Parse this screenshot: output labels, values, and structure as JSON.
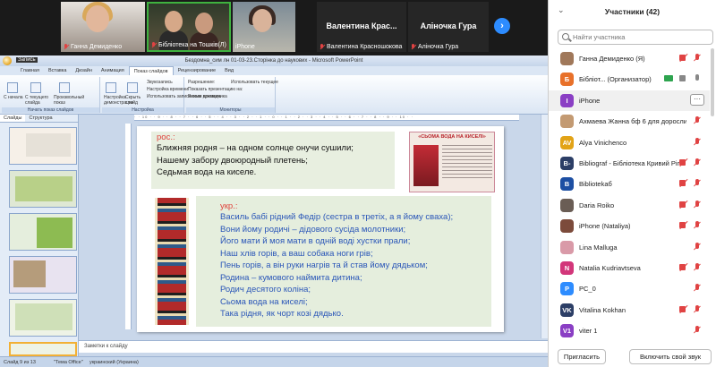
{
  "video": {
    "tiles": [
      {
        "name": "Ганна Демиденко"
      },
      {
        "name": "Бібліотека на Тошків(Л)"
      },
      {
        "name": "iPhone"
      },
      {
        "name": "Валентина Красношокова",
        "big": "Валентина Крас..."
      },
      {
        "name": "Аліночка Гура",
        "big": "Аліночка Гура"
      }
    ]
  },
  "ppt": {
    "recording_label": "Запись",
    "window_title": "Бездомна_сим лн 01-03-23.Сторінка до наукових - Microsoft PowerPoint",
    "tabs": [
      "Главная",
      "Вставка",
      "Дизайн",
      "Анимация",
      "Показ слайдов",
      "Рецензирование",
      "Вид"
    ],
    "ribbon": {
      "groups": [
        "Начать показ слайдов",
        "Настройка",
        "Мониторы"
      ],
      "items": [
        "С начала",
        "С текущего слайда",
        "Произвольный показ",
        "Настройка демонстрации",
        "Скрыть слайд",
        "Звукозапись",
        "Настройка времени",
        "Использовать записанные времена",
        "Разрешение:",
        "Использовать текущее",
        "Показать презентацию на:",
        "Режим докладчика"
      ]
    },
    "pane_tabs": [
      "Слайды",
      "Структура"
    ],
    "slide": {
      "ru_label": "рос.:",
      "ru_lines": [
        "Ближняя родня – на одном солнце онучи сушили;",
        "Нашему забору двоюродный плетень;",
        "Седьмая вода на киселе."
      ],
      "ua_label": "укр.:",
      "ua_lines": [
        "Василь бабі рідний Федір (сестра в третіх, а я йому сваха);",
        "Вони йому родичі – дідового сусіда молотники;",
        "Його мати й моя мати в одній воді хустки прали;",
        "Наш хлів горів, а ваш собака ноги грів;",
        "Пень горів, а він руки нагрів та й став йому дядьком;",
        "Родина – кумового наймита дитина;",
        "Родич десятого коліна;",
        "Сьома вода на киселі;",
        "Така рідня, як чорт козі дядько."
      ],
      "book_title": "«СЬОМА ВОДА НА КИСЕЛІ»"
    },
    "notes_placeholder": "Заметки к слайду",
    "status": {
      "slide": "Слайд 9 из 13",
      "theme": "\"Тема Office\"",
      "lang": "украинский (Украина)"
    }
  },
  "panel": {
    "title": "Участники (42)",
    "search_placeholder": "Найти участника",
    "participants": [
      {
        "name": "Ганна Демиденко (Я)",
        "initial": "",
        "color": "#a0785a",
        "cam": false,
        "mic": false
      },
      {
        "name": "Бібліот... (Организатор)",
        "initial": "Б",
        "color": "#e8712a",
        "cam": true,
        "mic": true,
        "share": true
      },
      {
        "name": "iPhone",
        "initial": "I",
        "color": "#8a3fc4",
        "highlight": true
      },
      {
        "name": "Ахмаева Жанна бф 6 для дорослих",
        "initial": "",
        "color": "#c39a72",
        "mic": false
      },
      {
        "name": "Alya Vinichenco",
        "initial": "AV",
        "color": "#e2a317",
        "mic": false
      },
      {
        "name": "Bibliograf - Бібліотека Кривий Ріг",
        "initial": "B-",
        "color": "#2c3e66",
        "cam": false,
        "mic": false
      },
      {
        "name": "Bibliotekaб",
        "initial": "B",
        "color": "#1d4fa3",
        "cam": false,
        "mic": false
      },
      {
        "name": "Daria Roiko",
        "initial": "",
        "color": "#6a5d55",
        "cam": false,
        "mic": false
      },
      {
        "name": "iPhone (Nataliya)",
        "initial": "",
        "color": "#7c4b3b",
        "cam": false,
        "mic": false
      },
      {
        "name": "Lina Malluga",
        "initial": "",
        "color": "#d99aa8",
        "mic": false
      },
      {
        "name": "Natalia Kudriavtseva",
        "initial": "N",
        "color": "#d2367a",
        "cam": false,
        "mic": false
      },
      {
        "name": "PC_0",
        "initial": "P",
        "color": "#2d8cff",
        "mic": false
      },
      {
        "name": "Vitalina Kokhan",
        "initial": "VK",
        "color": "#2c3e66",
        "cam": false,
        "mic": false
      },
      {
        "name": "viter 1",
        "initial": "V1",
        "color": "#8a3fc4",
        "mic": false
      }
    ],
    "invite_label": "Пригласить",
    "unmute_label": "Включить свой звук"
  }
}
